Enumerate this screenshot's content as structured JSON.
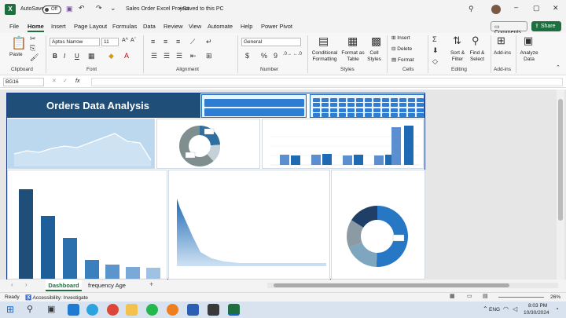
{
  "title_bar": {
    "autosave_label": "AutoSave",
    "autosave_state": "Off",
    "doc_title": "Sales Order Excel Project",
    "saved_status": "Saved to this PC"
  },
  "menu": [
    "File",
    "Home",
    "Insert",
    "Page Layout",
    "Formulas",
    "Data",
    "Review",
    "View",
    "Automate",
    "Help",
    "Power Pivot"
  ],
  "comments_label": "Comments",
  "share_label": "Share",
  "ribbon": {
    "paste": "Paste",
    "font_name": "Aptos Narrow",
    "font_size": "11",
    "number_format": "General",
    "bold": "B",
    "italic": "I",
    "underline": "U",
    "conditional": "Conditional Formatting",
    "format_table": "Format as Table",
    "cell_styles": "Cell Styles",
    "insert": "Insert",
    "delete": "Delete",
    "format": "Format",
    "sort": "Sort & Filter",
    "find": "Find & Select",
    "addins": "Add-ins",
    "analyze": "Analyze Data",
    "groups": {
      "clipboard": "Clipboard",
      "font": "Font",
      "alignment": "Alignment",
      "number": "Number",
      "styles": "Styles",
      "cells": "Cells",
      "editing": "Editing",
      "addins": "Add-ins"
    }
  },
  "name_box": "BG16",
  "fx": "fx",
  "dashboard": {
    "title": "Orders Data Analysis"
  },
  "tabs": [
    "Dashboard",
    "frequency Age"
  ],
  "status": {
    "ready": "Ready",
    "accessibility": "Accessibility: Investigate",
    "zoom": "26%"
  },
  "taskbar": {
    "time": "8:03 PM",
    "date": "10/30/2024",
    "lang": "ENG"
  },
  "colors": {
    "excel_green": "#1e6f3f",
    "dashboard_title_bg": "#1f4e79",
    "bar_blue": "#1f6ab4"
  }
}
